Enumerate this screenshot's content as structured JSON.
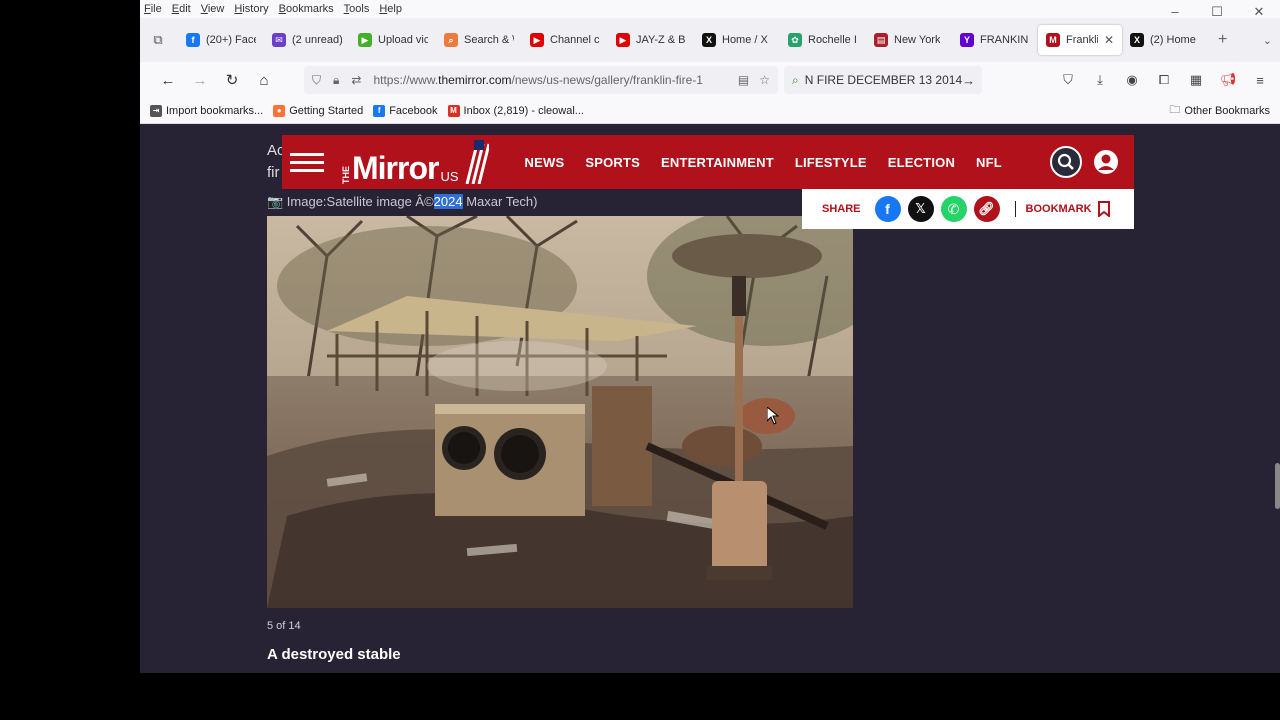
{
  "menubar": [
    "File",
    "Edit",
    "View",
    "History",
    "Bookmarks",
    "Tools",
    "Help"
  ],
  "tabs": [
    {
      "label": "(20+) Face",
      "icon": "facebook-icon",
      "color": "#1877f2",
      "glyph": "f"
    },
    {
      "label": "(2 unread)",
      "icon": "mail-icon",
      "color": "#6b3fc9",
      "glyph": "✉"
    },
    {
      "label": "Upload vic",
      "icon": "upload-icon",
      "color": "#43b02a",
      "glyph": "▶"
    },
    {
      "label": "Search & \\",
      "icon": "search-site-icon",
      "color": "#f07a3c",
      "glyph": "⌕"
    },
    {
      "label": "Channel c",
      "icon": "youtube-icon",
      "color": "#e00000",
      "glyph": "▶"
    },
    {
      "label": "JAY-Z & B",
      "icon": "youtube-icon",
      "color": "#e00000",
      "glyph": "▶"
    },
    {
      "label": "Home / X",
      "icon": "x-icon",
      "color": "#111111",
      "glyph": "X"
    },
    {
      "label": "Rochelle I",
      "icon": "paw-icon",
      "color": "#27a36a",
      "glyph": "✿"
    },
    {
      "label": "New York",
      "icon": "newspaper-icon",
      "color": "#a8202a",
      "glyph": "▤"
    },
    {
      "label": "FRANKIN",
      "icon": "yahoo-icon",
      "color": "#6001d2",
      "glyph": "Y"
    },
    {
      "label": "Frankli",
      "icon": "mirror-icon",
      "color": "#b0111a",
      "glyph": "M",
      "active": true
    },
    {
      "label": "(2) Home",
      "icon": "x-icon",
      "color": "#111111",
      "glyph": "X"
    }
  ],
  "url": {
    "prefix": "https://www.",
    "domain": "themirror.com",
    "path": "/news/us-news/gallery/franklin-fire-1"
  },
  "find": {
    "query": "N FIRE DECEMBER 13 2014"
  },
  "bookmarks": [
    {
      "label": "Import bookmarks...",
      "icon": "import-icon",
      "color": "#555555",
      "glyph": "⇥"
    },
    {
      "label": "Getting Started",
      "icon": "firefox-icon",
      "color": "#ff7139",
      "glyph": "●"
    },
    {
      "label": "Facebook",
      "icon": "facebook-icon",
      "color": "#1877f2",
      "glyph": "f"
    },
    {
      "label": "Inbox (2,819) - cleowal...",
      "icon": "gmail-icon",
      "color": "#d93025",
      "glyph": "M"
    }
  ],
  "other_bookmarks": "Other Bookmarks",
  "site": {
    "logo_the": "THE",
    "logo_name": "Mirror",
    "logo_region": "US",
    "nav": [
      "NEWS",
      "SPORTS",
      "ENTERTAINMENT",
      "LIFESTYLE",
      "ELECTION",
      "NFL"
    ],
    "share_label": "SHARE",
    "bookmark_label": "BOOKMARK",
    "brand_color": "#b0111a"
  },
  "article": {
    "text_line1": "Ac",
    "text_line2": "fir",
    "caption_prefix": "📷 Image:Satellite image Â©",
    "caption_highlight": "2024",
    "caption_suffix": " Maxar Tech)",
    "counter": "5 of 14",
    "photo_title": "A destroyed stable"
  }
}
